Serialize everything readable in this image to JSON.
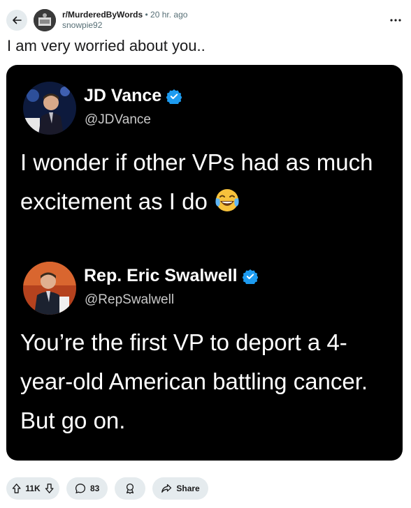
{
  "post": {
    "subreddit": "r/MurderedByWords",
    "separator": "•",
    "time": "20 hr. ago",
    "author": "snowpie92",
    "title": "I am very worried about you.."
  },
  "tweets": [
    {
      "name": "JD Vance",
      "handle": "@JDVance",
      "text": "I wonder if other VPs had as much excitement as I do",
      "emoji": "face-with-tears-of-joy"
    },
    {
      "name": "Rep. Eric Swalwell",
      "handle": "@RepSwalwell",
      "text": "You’re the first VP to deport a 4-year-old American battling cancer. But go on."
    }
  ],
  "actions": {
    "votes": "11K",
    "comments": "83",
    "share": "Share"
  },
  "colors": {
    "verified": "#1d9bf0",
    "pill_bg": "#e5ebee",
    "media_bg": "#000000"
  }
}
